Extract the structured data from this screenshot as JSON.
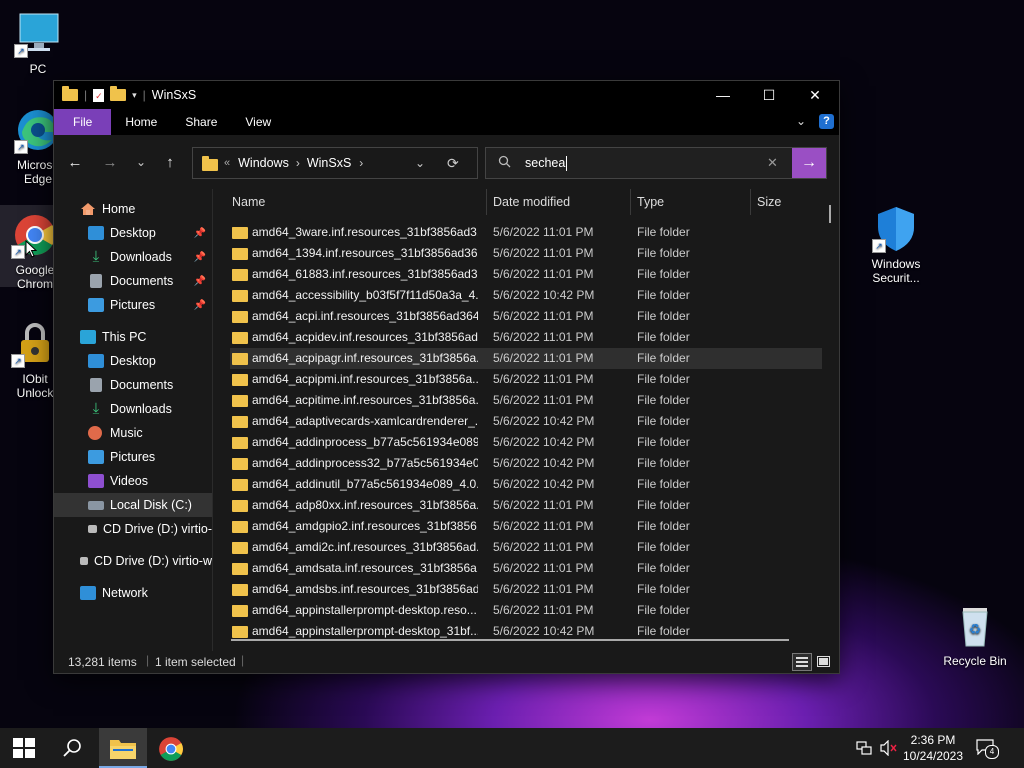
{
  "desktop": {
    "icons": [
      {
        "label": "PC",
        "icon": "pc-icon"
      },
      {
        "label": "Microsoft Edge",
        "icon": "edge-icon"
      },
      {
        "label": "Google Chrome",
        "icon": "chrome-icon"
      },
      {
        "label": "IObit Unlocker",
        "icon": "iobit-unlocker-icon"
      },
      {
        "label": "Windows Securit...",
        "icon": "windows-security-icon"
      },
      {
        "label": "Recycle Bin",
        "icon": "recycle-bin-icon"
      }
    ],
    "edge_label_lines": [
      "Microso",
      "Edge"
    ],
    "chrome_label_lines": [
      "Google",
      "Chrom"
    ],
    "iobit_label_lines": [
      "IObit",
      "Unlock"
    ],
    "security_label_lines": [
      "Windows",
      "Securit..."
    ]
  },
  "window": {
    "title": "WinSxS",
    "controls": {
      "minimize": "—",
      "maximize": "☐",
      "close": "✕"
    }
  },
  "ribbon": {
    "tabs": [
      "File",
      "Home",
      "Share",
      "View"
    ]
  },
  "address": {
    "prefix": "«",
    "crumbs": [
      "Windows",
      "WinSxS"
    ]
  },
  "search": {
    "value": "sechea"
  },
  "sidebar": {
    "items": [
      {
        "label": "Home",
        "icon": "home-icon",
        "level": 1,
        "pinned": false
      },
      {
        "label": "Desktop",
        "icon": "desktop-folder-icon",
        "level": 2,
        "pinned": true
      },
      {
        "label": "Downloads",
        "icon": "downloads-icon",
        "level": 2,
        "pinned": true
      },
      {
        "label": "Documents",
        "icon": "documents-icon",
        "level": 2,
        "pinned": true
      },
      {
        "label": "Pictures",
        "icon": "pictures-icon",
        "level": 2,
        "pinned": true
      },
      {
        "label": "This PC",
        "icon": "this-pc-icon",
        "level": 1,
        "pinned": false
      },
      {
        "label": "Desktop",
        "icon": "desktop-folder-icon",
        "level": 2,
        "pinned": false
      },
      {
        "label": "Documents",
        "icon": "documents-icon",
        "level": 2,
        "pinned": false
      },
      {
        "label": "Downloads",
        "icon": "downloads-icon",
        "level": 2,
        "pinned": false
      },
      {
        "label": "Music",
        "icon": "music-icon",
        "level": 2,
        "pinned": false
      },
      {
        "label": "Pictures",
        "icon": "pictures-icon",
        "level": 2,
        "pinned": false
      },
      {
        "label": "Videos",
        "icon": "videos-icon",
        "level": 2,
        "pinned": false
      },
      {
        "label": "Local Disk (C:)",
        "icon": "local-disk-icon",
        "level": 2,
        "pinned": false,
        "selected": true
      },
      {
        "label": "CD Drive (D:) virtio-",
        "icon": "cd-drive-icon",
        "level": 2,
        "pinned": false
      },
      {
        "label": "CD Drive (D:) virtio-w",
        "icon": "cd-drive-icon",
        "level": 1,
        "pinned": false
      },
      {
        "label": "Network",
        "icon": "network-icon",
        "level": 1,
        "pinned": false
      }
    ]
  },
  "columns": {
    "name": "Name",
    "date": "Date modified",
    "type": "Type",
    "size": "Size"
  },
  "files": [
    {
      "name": "amd64_3ware.inf.resources_31bf3856ad3...",
      "date": "5/6/2022 11:01 PM",
      "type": "File folder"
    },
    {
      "name": "amd64_1394.inf.resources_31bf3856ad36...",
      "date": "5/6/2022 11:01 PM",
      "type": "File folder"
    },
    {
      "name": "amd64_61883.inf.resources_31bf3856ad3...",
      "date": "5/6/2022 11:01 PM",
      "type": "File folder"
    },
    {
      "name": "amd64_accessibility_b03f5f7f11d50a3a_4....",
      "date": "5/6/2022 10:42 PM",
      "type": "File folder"
    },
    {
      "name": "amd64_acpi.inf.resources_31bf3856ad364...",
      "date": "5/6/2022 11:01 PM",
      "type": "File folder"
    },
    {
      "name": "amd64_acpidev.inf.resources_31bf3856ad...",
      "date": "5/6/2022 11:01 PM",
      "type": "File folder"
    },
    {
      "name": "amd64_acpipagr.inf.resources_31bf3856a...",
      "date": "5/6/2022 11:01 PM",
      "type": "File folder",
      "hover": true
    },
    {
      "name": "amd64_acpipmi.inf.resources_31bf3856a...",
      "date": "5/6/2022 11:01 PM",
      "type": "File folder"
    },
    {
      "name": "amd64_acpitime.inf.resources_31bf3856a...",
      "date": "5/6/2022 11:01 PM",
      "type": "File folder"
    },
    {
      "name": "amd64_adaptivecards-xamlcardrenderer_...",
      "date": "5/6/2022 10:42 PM",
      "type": "File folder"
    },
    {
      "name": "amd64_addinprocess_b77a5c561934e089...",
      "date": "5/6/2022 10:42 PM",
      "type": "File folder"
    },
    {
      "name": "amd64_addinprocess32_b77a5c561934e0...",
      "date": "5/6/2022 10:42 PM",
      "type": "File folder"
    },
    {
      "name": "amd64_addinutil_b77a5c561934e089_4.0....",
      "date": "5/6/2022 10:42 PM",
      "type": "File folder"
    },
    {
      "name": "amd64_adp80xx.inf.resources_31bf3856a...",
      "date": "5/6/2022 11:01 PM",
      "type": "File folder"
    },
    {
      "name": "amd64_amdgpio2.inf.resources_31bf3856...",
      "date": "5/6/2022 11:01 PM",
      "type": "File folder"
    },
    {
      "name": "amd64_amdi2c.inf.resources_31bf3856ad...",
      "date": "5/6/2022 11:01 PM",
      "type": "File folder"
    },
    {
      "name": "amd64_amdsata.inf.resources_31bf3856a...",
      "date": "5/6/2022 11:01 PM",
      "type": "File folder"
    },
    {
      "name": "amd64_amdsbs.inf.resources_31bf3856ad...",
      "date": "5/6/2022 11:01 PM",
      "type": "File folder"
    },
    {
      "name": "amd64_appinstallerprompt-desktop.reso...",
      "date": "5/6/2022 11:01 PM",
      "type": "File folder"
    },
    {
      "name": "amd64_appinstallerprompt-desktop_31bf...",
      "date": "5/6/2022 10:42 PM",
      "type": "File folder"
    }
  ],
  "status": {
    "count": "13,281 items",
    "selected": "1 item selected"
  },
  "taskbar": {
    "time": "2:36 PM",
    "date": "10/24/2023",
    "notifications": "4"
  },
  "colors": {
    "accent": "#9a4fc4",
    "folder": "#f0c24b",
    "file_tab": "#7a3fb8"
  }
}
